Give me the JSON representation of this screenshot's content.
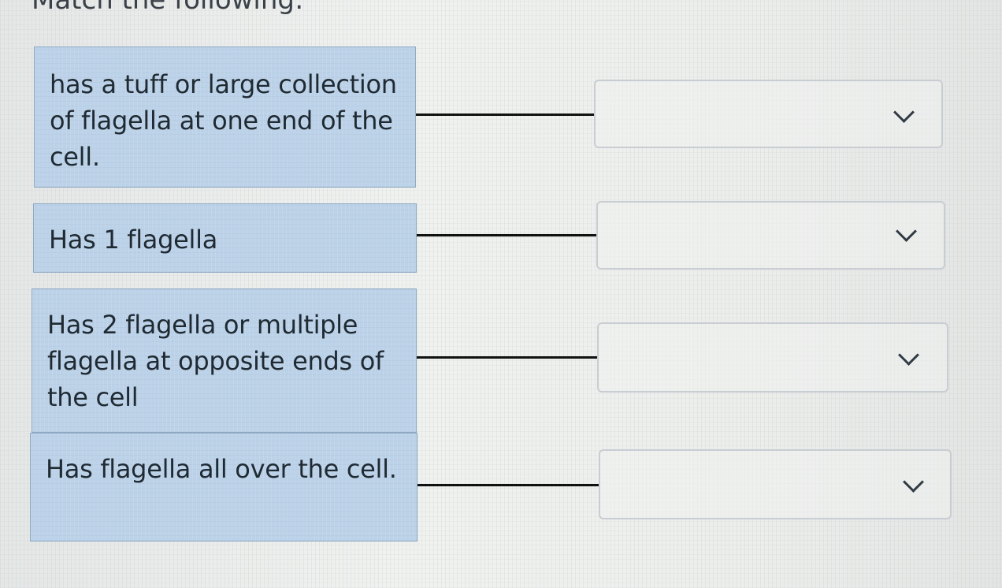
{
  "header": {
    "title": "Match the following:"
  },
  "items": [
    {
      "prompt": "has a tuff or large collection of flagella at one end of the cell.",
      "selected": ""
    },
    {
      "prompt": "Has 1 flagella",
      "selected": ""
    },
    {
      "prompt": "Has 2 flagella or multiple flagella at opposite ends of the cell",
      "selected": ""
    },
    {
      "prompt": "Has flagella all over the cell.",
      "selected": ""
    }
  ],
  "icons": {
    "dropdown": "chevron-down-icon"
  },
  "colors": {
    "prompt_background": "#bcd2e8",
    "prompt_border": "#8fa9c4",
    "connector": "#111111",
    "select_border": "#c7cdd2"
  }
}
